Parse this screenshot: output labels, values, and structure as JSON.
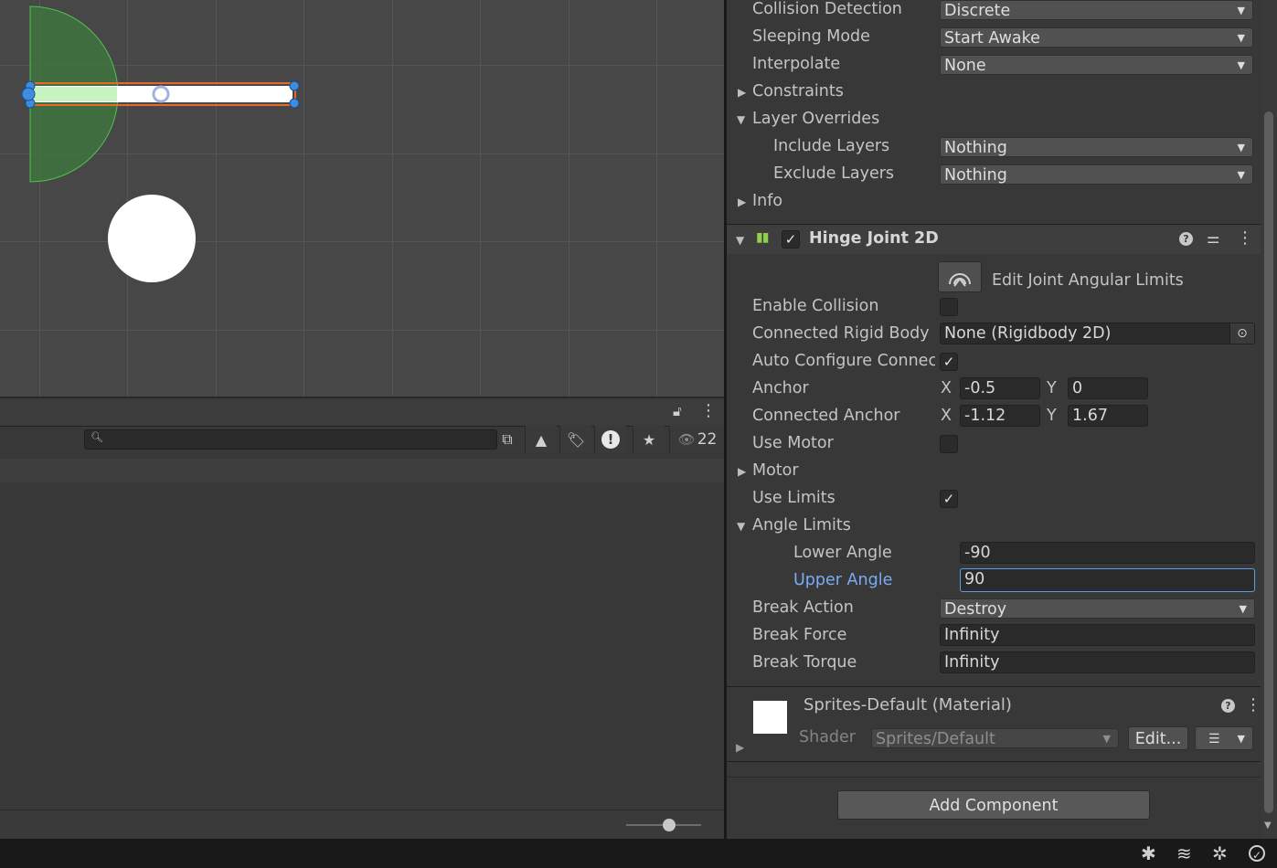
{
  "project": {
    "hidden_count": "22",
    "icons": [
      "lock-icon",
      "kebab-menu-icon",
      "search-icon",
      "external-link-icon",
      "type-filter-icon",
      "label-filter-icon",
      "error-icon",
      "favorite-icon",
      "eye-icon"
    ]
  },
  "inspector": {
    "rigidbody": {
      "collision_detection": {
        "label": "Collision Detection",
        "value": "Discrete"
      },
      "sleeping_mode": {
        "label": "Sleeping Mode",
        "value": "Start Awake"
      },
      "interpolate": {
        "label": "Interpolate",
        "value": "None"
      },
      "constraints": "Constraints",
      "layer_overrides": "Layer Overrides",
      "include_layers": {
        "label": "Include Layers",
        "value": "Nothing"
      },
      "exclude_layers": {
        "label": "Exclude Layers",
        "value": "Nothing"
      },
      "info": "Info"
    },
    "hinge": {
      "title": "Hinge Joint 2D",
      "edit_limits": "Edit Joint Angular Limits",
      "enable_collision": {
        "label": "Enable Collision",
        "checked": false
      },
      "connected_rigidbody": {
        "label": "Connected Rigid Body",
        "value": "None (Rigidbody 2D)"
      },
      "auto_configure": {
        "label": "Auto Configure Connec",
        "checked": true
      },
      "anchor": {
        "label": "Anchor",
        "x_label": "X",
        "x": "-0.5",
        "y_label": "Y",
        "y": "0"
      },
      "connected_anchor": {
        "label": "Connected Anchor",
        "x_label": "X",
        "x": "-1.12",
        "y_label": "Y",
        "y": "1.67"
      },
      "use_motor": {
        "label": "Use Motor",
        "checked": false
      },
      "motor": "Motor",
      "use_limits": {
        "label": "Use Limits",
        "checked": true
      },
      "angle_limits": "Angle Limits",
      "lower_angle": {
        "label": "Lower Angle",
        "value": "-90"
      },
      "upper_angle": {
        "label": "Upper Angle",
        "value": "90"
      },
      "break_action": {
        "label": "Break Action",
        "value": "Destroy"
      },
      "break_force": {
        "label": "Break Force",
        "value": "Infinity"
      },
      "break_torque": {
        "label": "Break Torque",
        "value": "Infinity"
      }
    },
    "material": {
      "title": "Sprites-Default (Material)",
      "shader_label": "Shader",
      "shader_value": "Sprites/Default",
      "edit_button": "Edit..."
    },
    "add_component": "Add Component"
  },
  "colors": {
    "accent": "#7babf5",
    "hinge_icon": "#8fd14f",
    "joint_arc": "#3e8a3e"
  }
}
